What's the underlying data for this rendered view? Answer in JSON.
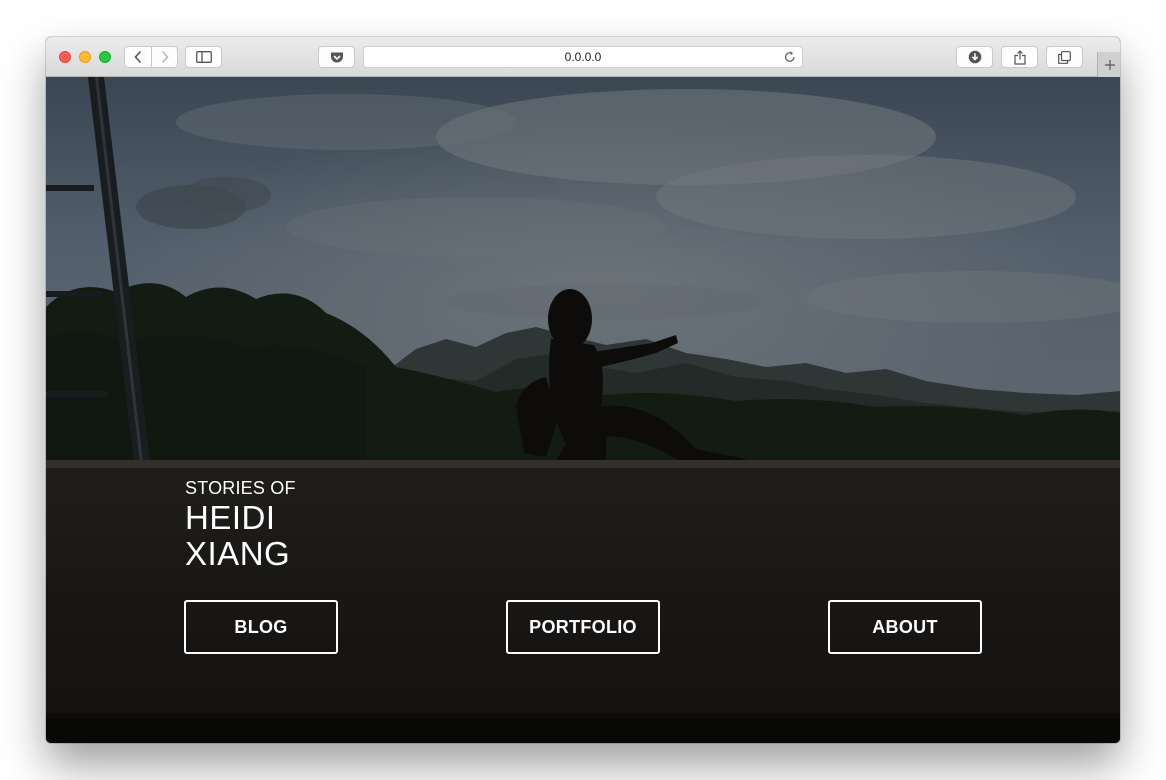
{
  "browser": {
    "url": "0.0.0.0",
    "icons": {
      "back": "chevron-left-icon",
      "forward": "chevron-right-icon",
      "sidebar": "sidebar-icon",
      "pocket": "pocket-icon",
      "reload": "reload-icon",
      "downloads": "download-icon",
      "share": "share-icon",
      "tabs": "tabs-overview-icon",
      "new_tab": "plus-icon"
    }
  },
  "hero": {
    "eyebrow": "STORIES OF",
    "name_line1": "HEIDI",
    "name_line2": "XIANG"
  },
  "nav": {
    "blog": "BLOG",
    "portfolio": "PORTFOLIO",
    "about": "ABOUT"
  },
  "colors": {
    "text": "#ffffff",
    "overlay": "#1b1916",
    "traffic_red": "#fc5f57",
    "traffic_yellow": "#fdbc2e",
    "traffic_green": "#28c840"
  }
}
